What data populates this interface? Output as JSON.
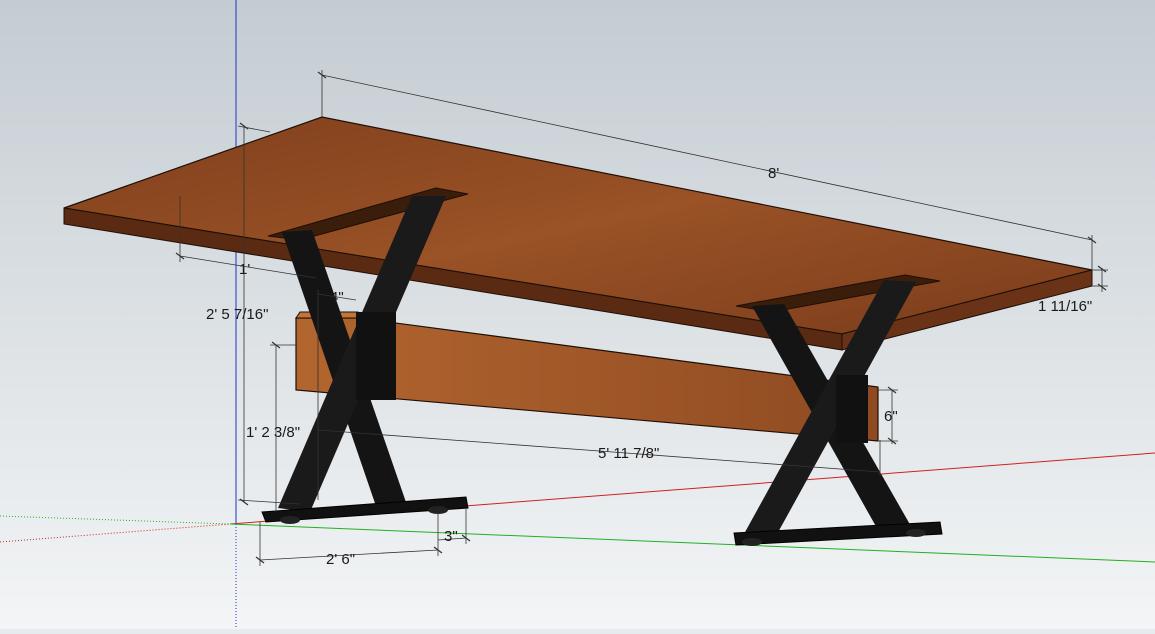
{
  "dimensions": {
    "length": "8'",
    "thickness": "1 11/16\"",
    "overhang": "1'",
    "leg_width": "4\"",
    "height": "2' 5 7/16\"",
    "beam_height": "6\"",
    "beam_elevation": "1' 2 3/8\"",
    "leg_span": "5' 11 7/8\"",
    "foot_length": "2' 6\"",
    "foot_width": "3\""
  },
  "colors": {
    "sky_top": "#c4ccd2",
    "sky_bottom": "#f3f5f6",
    "wood_top": "#8f4a22",
    "wood_edge": "#5a2b12",
    "beam": "#a0582b",
    "steel": "#141414",
    "axis_red": "#d02020",
    "axis_green": "#22b022",
    "axis_blue": "#2030d0"
  }
}
